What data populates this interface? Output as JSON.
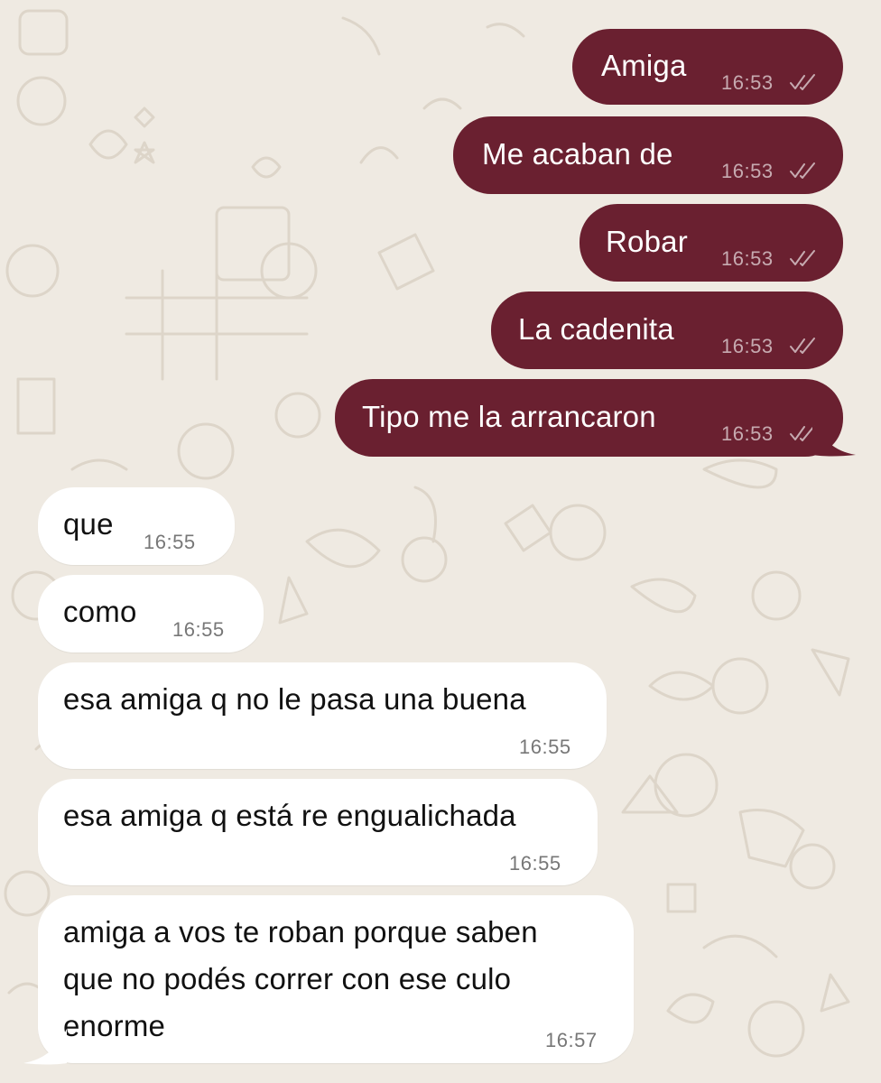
{
  "colors": {
    "background": "#efeae2",
    "outgoing_bubble": "#6a2030",
    "incoming_bubble": "#ffffff",
    "outgoing_text": "#ffffff",
    "incoming_text": "#111111"
  },
  "messages": [
    {
      "direction": "outgoing",
      "text": "Amiga",
      "time": "16:53",
      "status_icon": "double-check-icon"
    },
    {
      "direction": "outgoing",
      "text": "Me acaban de",
      "time": "16:53",
      "status_icon": "double-check-icon"
    },
    {
      "direction": "outgoing",
      "text": "Robar",
      "time": "16:53",
      "status_icon": "double-check-icon"
    },
    {
      "direction": "outgoing",
      "text": "La cadenita",
      "time": "16:53",
      "status_icon": "double-check-icon"
    },
    {
      "direction": "outgoing",
      "text": "Tipo me la arrancaron",
      "time": "16:53",
      "status_icon": "double-check-icon"
    },
    {
      "direction": "incoming",
      "text": "que",
      "time": "16:55"
    },
    {
      "direction": "incoming",
      "text": "como",
      "time": "16:55"
    },
    {
      "direction": "incoming",
      "text": "esa amiga q no le pasa una buena",
      "time": "16:55"
    },
    {
      "direction": "incoming",
      "text": "esa amiga q está re engualichada",
      "time": "16:55"
    },
    {
      "direction": "incoming",
      "text": "amiga a vos te roban porque saben\nque no podés correr con ese culo\nenorme",
      "time": "16:57"
    }
  ]
}
